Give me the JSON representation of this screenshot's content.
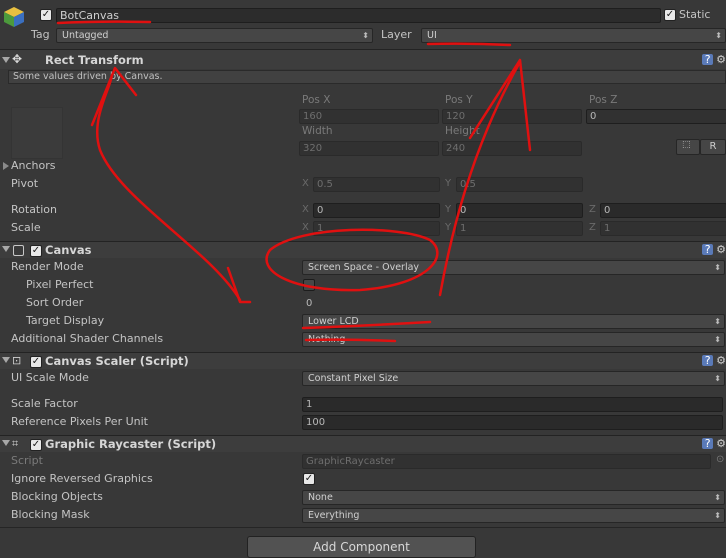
{
  "gameobject": {
    "active": true,
    "name": "BotCanvas",
    "static_label": "Static",
    "static": true,
    "tag_label": "Tag",
    "tag_value": "Untagged",
    "layer_label": "Layer",
    "layer_value": "UI"
  },
  "rect_transform": {
    "title": "Rect Transform",
    "note": "Some values driven by Canvas.",
    "pos_x_label": "Pos X",
    "pos_y_label": "Pos Y",
    "pos_z_label": "Pos Z",
    "pos_x": "160",
    "pos_y": "120",
    "pos_z": "0",
    "width_label": "Width",
    "height_label": "Height",
    "width": "320",
    "height": "240",
    "r_button": "R",
    "anchors_label": "Anchors",
    "pivot_label": "Pivot",
    "pivot_x": "0.5",
    "pivot_y": "0.5",
    "rotation_label": "Rotation",
    "rot_x": "0",
    "rot_y": "0",
    "rot_z": "0",
    "scale_label": "Scale",
    "scale_x": "1",
    "scale_y": "1",
    "scale_z": "1",
    "x": "X",
    "y": "Y",
    "z": "Z"
  },
  "canvas": {
    "title": "Canvas",
    "enabled": true,
    "render_mode_label": "Render Mode",
    "render_mode": "Screen Space - Overlay",
    "pixel_perfect_label": "Pixel Perfect",
    "pixel_perfect": false,
    "sort_order_label": "Sort Order",
    "sort_order": "0",
    "target_display_label": "Target Display",
    "target_display": "Lower LCD",
    "shader_channels_label": "Additional Shader Channels",
    "shader_channels": "Nothing"
  },
  "canvas_scaler": {
    "title": "Canvas Scaler (Script)",
    "enabled": true,
    "ui_scale_mode_label": "UI Scale Mode",
    "ui_scale_mode": "Constant Pixel Size",
    "scale_factor_label": "Scale Factor",
    "scale_factor": "1",
    "ref_ppu_label": "Reference Pixels Per Unit",
    "ref_ppu": "100"
  },
  "raycaster": {
    "title": "Graphic Raycaster (Script)",
    "enabled": true,
    "script_label": "Script",
    "script_value": "GraphicRaycaster",
    "ignore_reversed_label": "Ignore Reversed Graphics",
    "ignore_reversed": true,
    "blocking_objects_label": "Blocking Objects",
    "blocking_objects": "None",
    "blocking_mask_label": "Blocking Mask",
    "blocking_mask": "Everything"
  },
  "add_component": "Add Component",
  "check_glyph": "✓",
  "icons": [
    "gameobject-cube-icon",
    "rect-transform-icon",
    "help-icon",
    "gear-icon",
    "canvas-scaler-icon",
    "raycaster-icon",
    "dropdown-arrow-icon",
    "foldout-icon",
    "blueprint-icon",
    "object-picker-icon"
  ],
  "colors": {
    "background": "#383838",
    "annotation": "#e01010",
    "header": "#3d3d3d"
  }
}
